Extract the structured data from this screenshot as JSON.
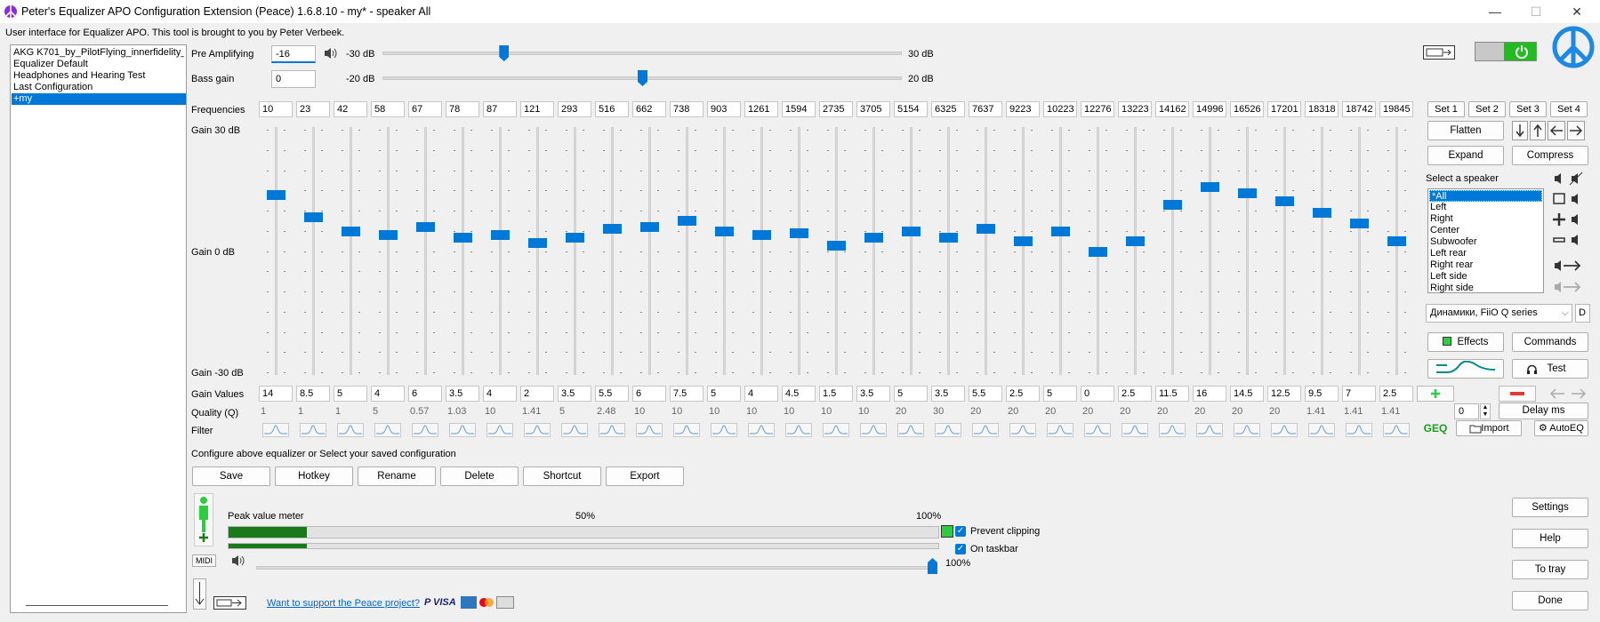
{
  "window": {
    "title": "Peter's Equalizer APO Configuration Extension (Peace) 1.6.8.10 - my* - speaker All",
    "subtitle": "User interface for Equalizer APO. This tool is brought to you by Peter Verbeek.",
    "minimize": "—",
    "maximize": "☐",
    "close": "✕"
  },
  "configs": [
    {
      "label": "AKG K701_by_PilotFlying_innerfidelity_AutoEQ"
    },
    {
      "label": "Equalizer Default"
    },
    {
      "label": "Headphones and Hearing Test"
    },
    {
      "label": "Last Configuration"
    },
    {
      "label": "+my",
      "selected": true
    }
  ],
  "preamp": {
    "label": "Pre Amplifying",
    "value": "-16",
    "min_label": "-30 dB",
    "max_label": "30 dB",
    "min": -30,
    "max": 30,
    "level": -16
  },
  "bass": {
    "label": "Bass gain",
    "value": "0",
    "min_label": "-20 dB",
    "max_label": "20 dB",
    "min": -20,
    "max": 20,
    "level": 0
  },
  "eq": {
    "frequencies_label": "Frequencies",
    "gain_top_label": "Gain 30 dB",
    "gain_mid_label": "Gain 0 dB",
    "gain_bottom_label": "Gain -30 dB",
    "gain_values_label": "Gain Values",
    "quality_label": "Quality (Q)",
    "filter_label": "Filter",
    "gain_min": -30,
    "gain_max": 30,
    "bands": [
      {
        "freq": "10",
        "gain": "14",
        "q": "1"
      },
      {
        "freq": "23",
        "gain": "8.5",
        "q": "1"
      },
      {
        "freq": "42",
        "gain": "5",
        "q": "1"
      },
      {
        "freq": "58",
        "gain": "4",
        "q": "5"
      },
      {
        "freq": "67",
        "gain": "6",
        "q": "0.57"
      },
      {
        "freq": "78",
        "gain": "3.5",
        "q": "1.03"
      },
      {
        "freq": "87",
        "gain": "4",
        "q": "10"
      },
      {
        "freq": "121",
        "gain": "2",
        "q": "1.41"
      },
      {
        "freq": "293",
        "gain": "3.5",
        "q": "5"
      },
      {
        "freq": "516",
        "gain": "5.5",
        "q": "2.48"
      },
      {
        "freq": "662",
        "gain": "6",
        "q": "10"
      },
      {
        "freq": "738",
        "gain": "7.5",
        "q": "10"
      },
      {
        "freq": "903",
        "gain": "5",
        "q": "10"
      },
      {
        "freq": "1261",
        "gain": "4",
        "q": "10"
      },
      {
        "freq": "1594",
        "gain": "4.5",
        "q": "10"
      },
      {
        "freq": "2735",
        "gain": "1.5",
        "q": "10"
      },
      {
        "freq": "3705",
        "gain": "3.5",
        "q": "10"
      },
      {
        "freq": "5154",
        "gain": "5",
        "q": "20"
      },
      {
        "freq": "6325",
        "gain": "3.5",
        "q": "30"
      },
      {
        "freq": "7637",
        "gain": "5.5",
        "q": "20"
      },
      {
        "freq": "9223",
        "gain": "2.5",
        "q": "20"
      },
      {
        "freq": "10223",
        "gain": "5",
        "q": "20"
      },
      {
        "freq": "12276",
        "gain": "0",
        "q": "20"
      },
      {
        "freq": "13223",
        "gain": "2.5",
        "q": "20"
      },
      {
        "freq": "14162",
        "gain": "11.5",
        "q": "20"
      },
      {
        "freq": "14996",
        "gain": "16",
        "q": "20"
      },
      {
        "freq": "16526",
        "gain": "14.5",
        "q": "20"
      },
      {
        "freq": "17201",
        "gain": "12.5",
        "q": "20"
      },
      {
        "freq": "18318",
        "gain": "9.5",
        "q": "1.41"
      },
      {
        "freq": "18742",
        "gain": "7",
        "q": "1.41"
      },
      {
        "freq": "19845",
        "gain": "2.5",
        "q": "1.41"
      }
    ]
  },
  "sets": [
    "Set 1",
    "Set 2",
    "Set 3",
    "Set 4"
  ],
  "buttons": {
    "flatten": "Flatten",
    "expand": "Expand",
    "compress": "Compress",
    "effects": "Effects",
    "commands": "Commands",
    "test": "Test",
    "delay": "Delay ms",
    "delay_value": "0",
    "import": "Import",
    "autoeq": "AutoEQ",
    "geq": "GEQ",
    "d": "D"
  },
  "speaker": {
    "label": "Select a speaker",
    "items": [
      "*All",
      "Left",
      "Right",
      "Center",
      "Subwoofer",
      "Left rear",
      "Right rear",
      "Left side",
      "Right side"
    ],
    "device": "Динамики, FiiO Q series"
  },
  "config_section": {
    "label": "Configure above equalizer or Select your saved configuration",
    "buttons": [
      "Save",
      "Hotkey",
      "Rename",
      "Delete",
      "Shortcut",
      "Export"
    ]
  },
  "meter": {
    "label": "Peak value meter",
    "mark50": "50%",
    "mark100": "100%",
    "level1": 0.11,
    "level2": 0.11,
    "volume_label": "100%",
    "prevent_clipping": "Prevent clipping",
    "on_taskbar": "On taskbar",
    "midi": "MIDI"
  },
  "support": {
    "link": "Want to support the Peace project?"
  },
  "right_buttons": {
    "settings": "Settings",
    "help": "Help",
    "to_tray": "To tray",
    "done": "Done"
  },
  "colors": {
    "accent": "#0078d7",
    "power_green": "#22bb22",
    "meter_green": "#1a7a1a",
    "logo_blue": "#1e88e5",
    "link": "#0066cc"
  }
}
